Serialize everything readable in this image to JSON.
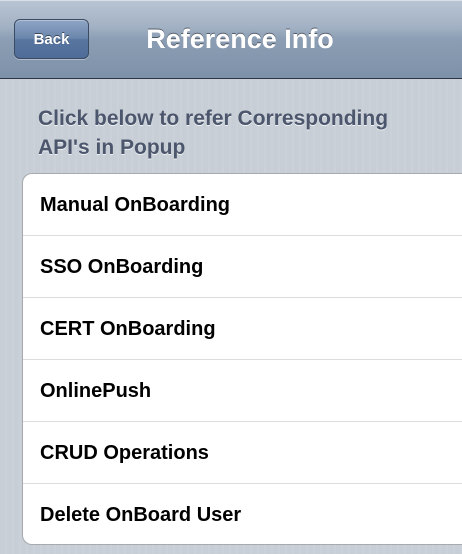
{
  "navbar": {
    "back_label": "Back",
    "title": "Reference Info"
  },
  "instruction": {
    "line1": "Click below to refer Corresponding",
    "line2": "API's in Popup"
  },
  "menu": {
    "items": [
      {
        "label": "Manual OnBoarding"
      },
      {
        "label": "SSO OnBoarding"
      },
      {
        "label": "CERT OnBoarding"
      },
      {
        "label": "OnlinePush"
      },
      {
        "label": "CRUD Operations"
      },
      {
        "label": "Delete OnBoard User"
      }
    ]
  },
  "colors": {
    "background": "#c5ccd4",
    "navbar": "#8c9eb4",
    "instruction_text": "#4c566c",
    "row_text": "#000000"
  }
}
